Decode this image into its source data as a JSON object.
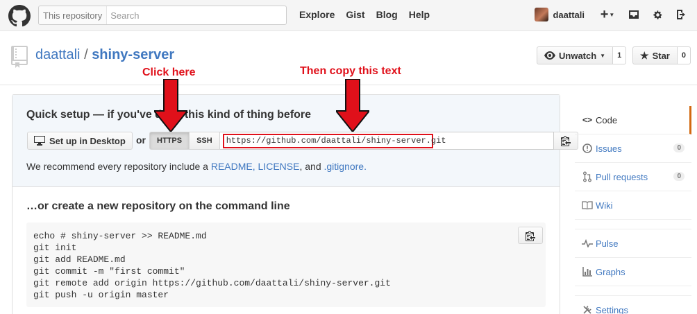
{
  "header": {
    "search_scope": "This repository",
    "search_placeholder": "Search",
    "nav": [
      "Explore",
      "Gist",
      "Blog",
      "Help"
    ],
    "username": "daattali",
    "icons": [
      "github-logo-icon",
      "plus-icon",
      "caret-down-icon",
      "inbox-icon",
      "gear-icon",
      "sign-out-icon"
    ]
  },
  "repo": {
    "owner": "daattali",
    "separator": "/",
    "name": "shiny-server",
    "watch_label": "Unwatch",
    "watch_count": "1",
    "star_label": "Star",
    "star_count": "0"
  },
  "annotations": {
    "click_here": "Click here",
    "copy_text": "Then copy this text",
    "color": "#e0101a"
  },
  "quick_setup": {
    "title": "Quick setup — if you've done this kind of thing before",
    "desktop_button": "Set up in Desktop",
    "or": "or",
    "https_label": "HTTPS",
    "ssh_label": "SSH",
    "clone_url": "https://github.com/daattali/shiny-server.git",
    "recommend_prefix": "We recommend every repository include a ",
    "readme_link": "README",
    "comma": ", ",
    "license_link": "LICENSE",
    "and_text": ", and ",
    "gitignore_link": ".gitignore",
    "period": "."
  },
  "command_line": {
    "title": "…or create a new repository on the command line",
    "lines": "echo # shiny-server >> README.md\ngit init\ngit add README.md\ngit commit -m \"first commit\"\ngit remote add origin https://github.com/daattali/shiny-server.git\ngit push -u origin master"
  },
  "sidebar": {
    "items": [
      {
        "label": "Code",
        "icon": "code-icon"
      },
      {
        "label": "Issues",
        "icon": "issue-icon",
        "count": "0"
      },
      {
        "label": "Pull requests",
        "icon": "pull-request-icon",
        "count": "0"
      },
      {
        "label": "Wiki",
        "icon": "book-icon"
      },
      {
        "label": "Pulse",
        "icon": "pulse-icon"
      },
      {
        "label": "Graphs",
        "icon": "graph-icon"
      },
      {
        "label": "Settings",
        "icon": "tools-icon"
      }
    ]
  }
}
